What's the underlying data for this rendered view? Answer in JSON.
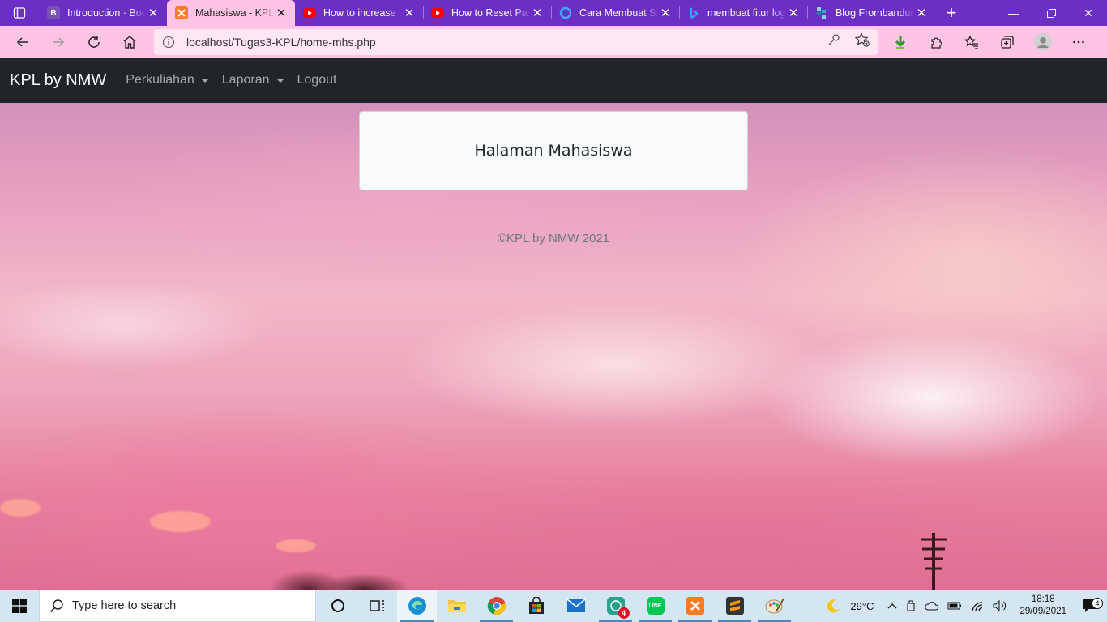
{
  "tabs": [
    {
      "title": "Introduction · Bootstrap",
      "favicon": "B",
      "color": "#7952b3",
      "active": false
    },
    {
      "title": "Mahasiswa - KPL",
      "favicon": "xampp",
      "color": "#fb7a24",
      "active": true
    },
    {
      "title": "How to increase session",
      "favicon": "youtube",
      "color": "#ff0000",
      "active": false
    },
    {
      "title": "How to Reset Password",
      "favicon": "youtube",
      "color": "#ff0000",
      "active": false
    },
    {
      "title": "Cara Membuat Sistem",
      "favicon": "edge-circle",
      "color": "#1f5fad",
      "active": false
    },
    {
      "title": "membuat fitur login",
      "favicon": "bing",
      "color": "#1a73e8",
      "active": false
    },
    {
      "title": "Blog Frombandung",
      "favicon": "blog",
      "color": "#2f7fa0",
      "active": false
    }
  ],
  "address": {
    "url": "localhost/Tugas3-KPL/home-mhs.php"
  },
  "navbar": {
    "brand": "KPL by NMW",
    "items": [
      {
        "label": "Perkuliahan",
        "dropdown": true
      },
      {
        "label": "Laporan",
        "dropdown": true
      },
      {
        "label": "Logout",
        "dropdown": false
      }
    ]
  },
  "card": {
    "title": "Halaman Mahasiswa"
  },
  "footer": {
    "text": "©KPL by NMW 2021"
  },
  "taskbar": {
    "search_placeholder": "Type here to search",
    "weather": "29°C",
    "time": "18:18",
    "date": "29/09/2021",
    "notification_count": "4",
    "whatsapp_badge": "4"
  },
  "colors": {
    "tabstrip": "#6b2fc4",
    "toolbar": "#ffc4e4",
    "navbar": "#212529",
    "taskbar": "#d4e6f1"
  }
}
